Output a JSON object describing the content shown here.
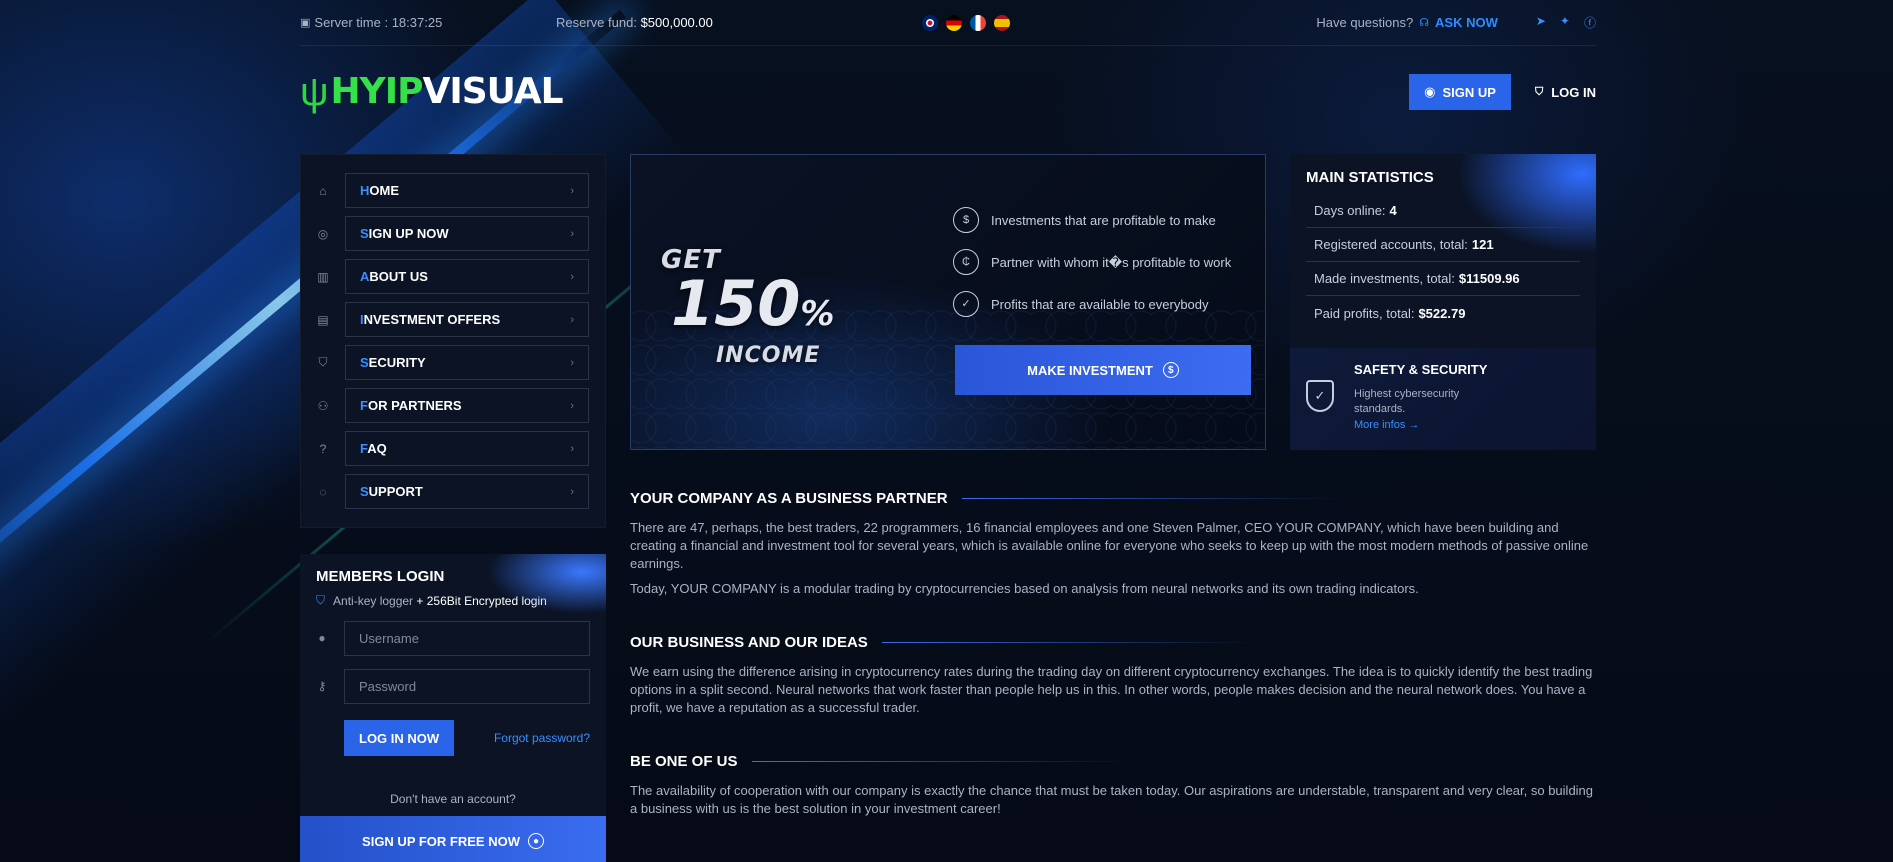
{
  "topbar": {
    "server_time": "Server time : 18:37:25",
    "reserve_label": "Reserve fund:",
    "reserve_value": "$500,000.00",
    "have_questions": "Have questions?",
    "ask_now": "ASK NOW"
  },
  "logo": {
    "part1": "HYIP",
    "part2": "VISUAL"
  },
  "header": {
    "sign_up": "SIGN UP",
    "log_in": "LOG IN"
  },
  "nav": [
    {
      "first": "H",
      "rest": "OME"
    },
    {
      "first": "S",
      "rest": "IGN UP NOW"
    },
    {
      "first": "A",
      "rest": "BOUT US"
    },
    {
      "first": "I",
      "rest": "NVESTMENT OFFERS"
    },
    {
      "first": "S",
      "rest": "ECURITY"
    },
    {
      "first": "F",
      "rest": "OR PARTNERS"
    },
    {
      "first": "F",
      "rest": "AQ"
    },
    {
      "first": "S",
      "rest": "UPPORT"
    }
  ],
  "login": {
    "title": "MEMBERS LOGIN",
    "anti_key": "Anti-key logger",
    "encrypted": "+ 256Bit Encrypted login",
    "username_placeholder": "Username",
    "password_placeholder": "Password",
    "login_btn": "LOG IN NOW",
    "forgot": "Forgot password?",
    "no_account": "Don't have an account?",
    "signup_free": "SIGN UP FOR FREE NOW"
  },
  "hero": {
    "get": "GET",
    "percent": "150",
    "pct_sign": "%",
    "income": "INCOME",
    "features": [
      "Investments that are profitable to make",
      "Partner with whom it�s profitable to work",
      "Profits that are available to everybody"
    ],
    "invest_btn": "MAKE INVESTMENT"
  },
  "stats": {
    "title": "MAIN STATISTICS",
    "rows": [
      {
        "label": "Days online:",
        "value": "4"
      },
      {
        "label": "Registered accounts, total:",
        "value": "121"
      },
      {
        "label": "Made investments, total:",
        "value": "$11509.96"
      },
      {
        "label": "Paid profits, total:",
        "value": "$522.79"
      }
    ],
    "safety_title": "SAFETY & SECURITY",
    "safety_text": "Highest cybersecurity standards.",
    "more_infos": "More infos →"
  },
  "sections": [
    {
      "title": "YOUR COMPANY AS A BUSINESS PARTNER",
      "paras": [
        "There are 47, perhaps, the best traders, 22 programmers, 16 financial employees and one Steven Palmer, CEO YOUR COMPANY, which have been building and creating a financial and investment tool for several years, which is available online for everyone who seeks to keep up with the most modern methods of passive online earnings.",
        "Today, YOUR COMPANY is a modular trading by cryptocurrencies based on analysis from neural networks and its own trading indicators."
      ]
    },
    {
      "title": "OUR BUSINESS AND OUR IDEAS",
      "paras": [
        "We earn using the difference arising in cryptocurrency rates during the trading day on different cryptocurrency exchanges. The idea is to quickly identify the best trading options in a split second. Neural networks that work faster than people help us in this. In other words, people makes decision and the neural network does. You have a profit, we have a reputation as a successful trader."
      ]
    },
    {
      "title": "BE ONE OF US",
      "paras": [
        "The availability of cooperation with our company is exactly the chance that must be taken today. Our aspirations are understable, transparent and very clear, so building a business with us is the best solution in your investment career!"
      ]
    }
  ]
}
